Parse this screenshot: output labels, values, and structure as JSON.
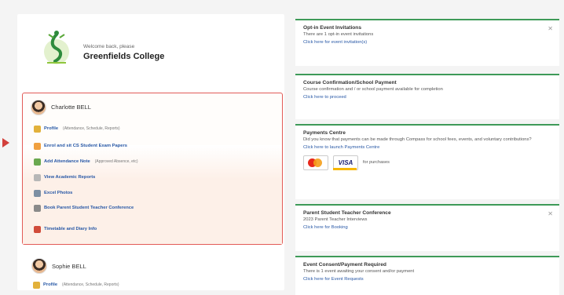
{
  "school": {
    "subtitle": "Welcome back, please",
    "name": "Greenfields College"
  },
  "students": [
    {
      "name": "Charlotte BELL",
      "menu": [
        {
          "label": "Profile",
          "extra": "(Attendance, Schedule, Reports)",
          "color": "#e2b13b"
        },
        {
          "label": "Enrol and sit CS Student Exam Papers",
          "extra": "",
          "color": "#f0a040"
        },
        {
          "label": "Add Attendance Note",
          "extra": "(Approved Absence, etc)",
          "color": "#6aa84f"
        },
        {
          "label": "View Academic Reports",
          "extra": "",
          "color": "#b7b7b7"
        },
        {
          "label": "Excel Photos",
          "extra": "",
          "color": "#7d8fa3"
        },
        {
          "label": "Book Parent Student Teacher Conference",
          "extra": "",
          "color": "#8a8a8a"
        },
        {
          "label": "Timetable and Diary Info",
          "extra": "",
          "color": "#d14b3a"
        }
      ]
    },
    {
      "name": "Sophie BELL",
      "menu": [
        {
          "label": "Profile",
          "extra": "(Attendance, Schedule, Reports)",
          "color": "#e2b13b"
        }
      ]
    }
  ],
  "cards": [
    {
      "title": "Opt-in Event Invitations",
      "desc": "There are 1 opt-in event invitations",
      "link": "Click here for event invitation(s)",
      "closable": true
    },
    {
      "title": "Course Confirmation/School Payment",
      "desc": "Course confirmation and / or school payment available for completion",
      "link": "Click here to proceed",
      "closable": false
    },
    {
      "title": "Payments Centre",
      "desc": "Did you know that payments can be made through Compass for school fees, events, and voluntary contributions?",
      "link": "Click here to launch Payments Centre",
      "closable": false,
      "payment": {
        "mastercard": "mastercard",
        "visa": "VISA",
        "note": "for purchases"
      }
    },
    {
      "title": "Parent Student Teacher Conference",
      "desc": "2023 Parent Teacher Interviews",
      "link": "Click here for Booking",
      "closable": true
    },
    {
      "title": "Event Consent/Payment Required",
      "desc": "There is 1 event awaiting your consent and/or payment",
      "link": "Click here for Event Requests",
      "closable": false
    }
  ],
  "colors": {
    "accent_green": "#3e9a58",
    "highlight_red": "#e25b57",
    "link_blue": "#2858a6"
  }
}
